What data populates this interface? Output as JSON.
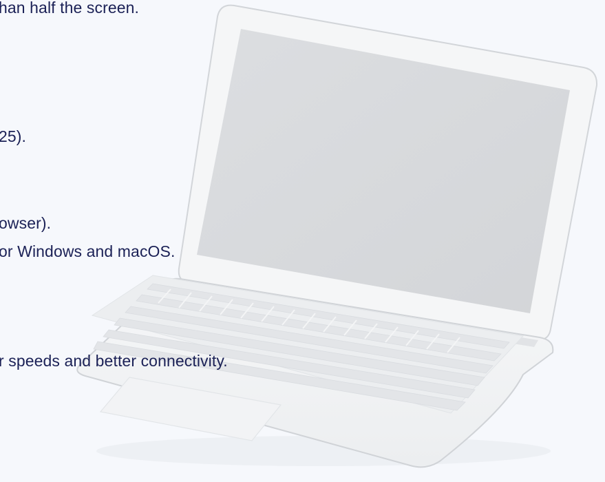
{
  "requirements": {
    "lines": [
      "han half the screen.",
      "25).",
      "owser).",
      "or Windows and macOS.",
      "r speeds and better connectivity."
    ]
  },
  "image": {
    "subject": "laptop-icon",
    "colors": {
      "background": "#f6f8fc",
      "text": "#1b2156",
      "screen": "#d8dadd",
      "body": "#f3f4f5",
      "outline": "#d0d3d7",
      "keys": "#e6e8ea"
    }
  }
}
